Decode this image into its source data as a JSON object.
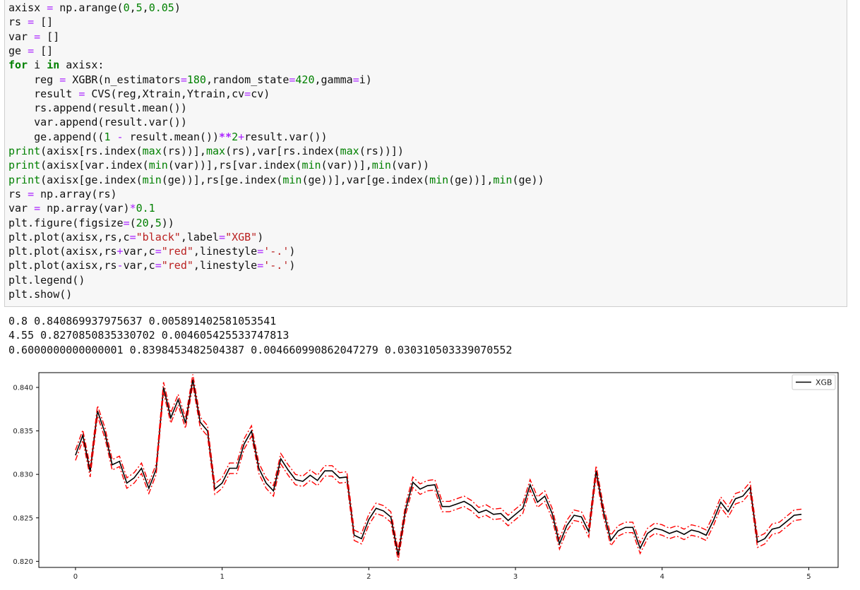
{
  "code": {
    "lines": [
      [
        [
          "axisx ",
          ""
        ],
        [
          "=",
          "op"
        ],
        [
          " np.arange(",
          ""
        ],
        [
          "0",
          "num"
        ],
        [
          ",",
          ""
        ],
        [
          "5",
          "num"
        ],
        [
          ",",
          ""
        ],
        [
          "0.05",
          "num"
        ],
        [
          ")",
          ""
        ]
      ],
      [
        [
          "rs ",
          ""
        ],
        [
          "=",
          "op"
        ],
        [
          " []",
          ""
        ]
      ],
      [
        [
          "var ",
          ""
        ],
        [
          "=",
          "op"
        ],
        [
          " []",
          ""
        ]
      ],
      [
        [
          "ge ",
          ""
        ],
        [
          "=",
          "op"
        ],
        [
          " []",
          ""
        ]
      ],
      [
        [
          "for",
          "kw"
        ],
        [
          " i ",
          ""
        ],
        [
          "in",
          "kw"
        ],
        [
          " axisx:",
          ""
        ]
      ],
      [
        [
          "    reg ",
          ""
        ],
        [
          "=",
          "op"
        ],
        [
          " XGBR(n_estimators",
          ""
        ],
        [
          "=",
          "op"
        ],
        [
          "180",
          "num"
        ],
        [
          ",random_state",
          ""
        ],
        [
          "=",
          "op"
        ],
        [
          "420",
          "num"
        ],
        [
          ",gamma",
          ""
        ],
        [
          "=",
          "op"
        ],
        [
          "i)",
          ""
        ]
      ],
      [
        [
          "    result ",
          ""
        ],
        [
          "=",
          "op"
        ],
        [
          " CVS(reg,Xtrain,Ytrain,cv",
          ""
        ],
        [
          "=",
          "op"
        ],
        [
          "cv)",
          ""
        ]
      ],
      [
        [
          "    rs.append(result.mean())",
          ""
        ]
      ],
      [
        [
          "    var.append(result.var())",
          ""
        ]
      ],
      [
        [
          "    ge.append((",
          ""
        ],
        [
          "1",
          "num"
        ],
        [
          " ",
          ""
        ],
        [
          "-",
          "op"
        ],
        [
          " result.mean())",
          ""
        ],
        [
          "**",
          "opk"
        ],
        [
          "2",
          "num"
        ],
        [
          "+",
          "op"
        ],
        [
          "result.var())",
          ""
        ]
      ],
      [
        [
          "print",
          "bi"
        ],
        [
          "(axisx[rs.index(",
          ""
        ],
        [
          "max",
          "bi"
        ],
        [
          "(rs))],",
          ""
        ],
        [
          "max",
          "bi"
        ],
        [
          "(rs),var[rs.index(",
          ""
        ],
        [
          "max",
          "bi"
        ],
        [
          "(rs))])",
          ""
        ]
      ],
      [
        [
          "print",
          "bi"
        ],
        [
          "(axisx[var.index(",
          ""
        ],
        [
          "min",
          "bi"
        ],
        [
          "(var))],rs[var.index(",
          ""
        ],
        [
          "min",
          "bi"
        ],
        [
          "(var))],",
          ""
        ],
        [
          "min",
          "bi"
        ],
        [
          "(var))",
          ""
        ]
      ],
      [
        [
          "print",
          "bi"
        ],
        [
          "(axisx[ge.index(",
          ""
        ],
        [
          "min",
          "bi"
        ],
        [
          "(ge))],rs[ge.index(",
          ""
        ],
        [
          "min",
          "bi"
        ],
        [
          "(ge))],var[ge.index(",
          ""
        ],
        [
          "min",
          "bi"
        ],
        [
          "(ge))],",
          ""
        ],
        [
          "min",
          "bi"
        ],
        [
          "(ge))",
          ""
        ]
      ],
      [
        [
          "rs ",
          ""
        ],
        [
          "=",
          "op"
        ],
        [
          " np.array(rs)",
          ""
        ]
      ],
      [
        [
          "var ",
          ""
        ],
        [
          "=",
          "op"
        ],
        [
          " np.array(var)",
          ""
        ],
        [
          "*",
          "op"
        ],
        [
          "0.1",
          "num"
        ]
      ],
      [
        [
          "plt.figure(figsize",
          ""
        ],
        [
          "=",
          "op"
        ],
        [
          "(",
          ""
        ],
        [
          "20",
          "num"
        ],
        [
          ",",
          ""
        ],
        [
          "5",
          "num"
        ],
        [
          "))",
          ""
        ]
      ],
      [
        [
          "plt.plot(axisx,rs,c",
          ""
        ],
        [
          "=",
          "op"
        ],
        [
          "\"black\"",
          "str"
        ],
        [
          ",label",
          ""
        ],
        [
          "=",
          "op"
        ],
        [
          "\"XGB\"",
          "str"
        ],
        [
          ")",
          ""
        ]
      ],
      [
        [
          "plt.plot(axisx,rs",
          ""
        ],
        [
          "+",
          "op"
        ],
        [
          "var,c",
          ""
        ],
        [
          "=",
          "op"
        ],
        [
          "\"red\"",
          "str"
        ],
        [
          ",linestyle",
          ""
        ],
        [
          "=",
          "op"
        ],
        [
          "'-.'",
          "str"
        ],
        [
          ")",
          ""
        ]
      ],
      [
        [
          "plt.plot(axisx,rs",
          ""
        ],
        [
          "-",
          "op"
        ],
        [
          "var,c",
          ""
        ],
        [
          "=",
          "op"
        ],
        [
          "\"red\"",
          "str"
        ],
        [
          ",linestyle",
          ""
        ],
        [
          "=",
          "op"
        ],
        [
          "'-.'",
          "str"
        ],
        [
          ")",
          ""
        ]
      ],
      [
        [
          "plt.legend()",
          ""
        ]
      ],
      [
        [
          "plt.show()",
          ""
        ]
      ]
    ]
  },
  "output": {
    "line1": "0.8 0.840869937975637 0.005891402581053541",
    "line2": "4.55 0.8270850835330702 0.004605425533747813",
    "line3": "0.6000000000000001 0.8398453482504387 0.004660990862047279 0.030310503339070552"
  },
  "chart_data": {
    "type": "line",
    "title": "",
    "xlabel": "",
    "ylabel": "",
    "xlim": [
      -0.25,
      5.2
    ],
    "ylim": [
      0.8193,
      0.8417
    ],
    "xticks": [
      "0",
      "1",
      "2",
      "3",
      "4",
      "5"
    ],
    "yticks": [
      "0.820",
      "0.825",
      "0.830",
      "0.835",
      "0.840"
    ],
    "legend_position": "top-right",
    "legend": [
      "XGB"
    ],
    "grid": false,
    "x": [
      0.0,
      0.05,
      0.1,
      0.15,
      0.2,
      0.25,
      0.3,
      0.35,
      0.4,
      0.45,
      0.5,
      0.55,
      0.6,
      0.65,
      0.7,
      0.75,
      0.8,
      0.85,
      0.9,
      0.95,
      1.0,
      1.05,
      1.1,
      1.15,
      1.2,
      1.25,
      1.3,
      1.35,
      1.4,
      1.45,
      1.5,
      1.55,
      1.6,
      1.65,
      1.7,
      1.75,
      1.8,
      1.85,
      1.9,
      1.95,
      2.0,
      2.05,
      2.1,
      2.15,
      2.2,
      2.25,
      2.3,
      2.35,
      2.4,
      2.45,
      2.5,
      2.55,
      2.6,
      2.65,
      2.7,
      2.75,
      2.8,
      2.85,
      2.9,
      2.95,
      3.0,
      3.05,
      3.1,
      3.15,
      3.2,
      3.25,
      3.3,
      3.35,
      3.4,
      3.45,
      3.5,
      3.55,
      3.6,
      3.65,
      3.7,
      3.75,
      3.8,
      3.85,
      3.9,
      3.95,
      4.0,
      4.05,
      4.1,
      4.15,
      4.2,
      4.25,
      4.3,
      4.35,
      4.4,
      4.45,
      4.5,
      4.55,
      4.6,
      4.65,
      4.7,
      4.75,
      4.8,
      4.85,
      4.9,
      4.95
    ],
    "series": [
      {
        "name": "XGB",
        "color": "#000000",
        "linestyle": "solid",
        "values": [
          0.8322,
          0.8345,
          0.8303,
          0.8373,
          0.8348,
          0.8311,
          0.8315,
          0.829,
          0.8296,
          0.8307,
          0.8284,
          0.8306,
          0.84,
          0.8365,
          0.8386,
          0.8359,
          0.8409,
          0.836,
          0.835,
          0.8283,
          0.829,
          0.8307,
          0.8307,
          0.8335,
          0.835,
          0.8307,
          0.829,
          0.8281,
          0.8318,
          0.8305,
          0.8294,
          0.8292,
          0.8299,
          0.8293,
          0.8304,
          0.8304,
          0.8296,
          0.8297,
          0.823,
          0.8226,
          0.8248,
          0.8261,
          0.8258,
          0.8251,
          0.8207,
          0.8259,
          0.8291,
          0.8283,
          0.8287,
          0.8288,
          0.8263,
          0.8263,
          0.8266,
          0.8269,
          0.8264,
          0.8256,
          0.8259,
          0.8254,
          0.8255,
          0.8247,
          0.8254,
          0.8261,
          0.8288,
          0.8268,
          0.8275,
          0.8255,
          0.822,
          0.8241,
          0.8253,
          0.8251,
          0.8234,
          0.8304,
          0.8257,
          0.8224,
          0.8235,
          0.8239,
          0.8239,
          0.8215,
          0.8232,
          0.8238,
          0.8236,
          0.8232,
          0.8235,
          0.8231,
          0.8236,
          0.8234,
          0.823,
          0.8247,
          0.8268,
          0.8257,
          0.8272,
          0.8275,
          0.8285,
          0.8222,
          0.8226,
          0.8237,
          0.8239,
          0.8246,
          0.8253,
          0.8254
        ]
      }
    ],
    "band": {
      "color": "#ff0000",
      "linestyle": "-."
    }
  }
}
